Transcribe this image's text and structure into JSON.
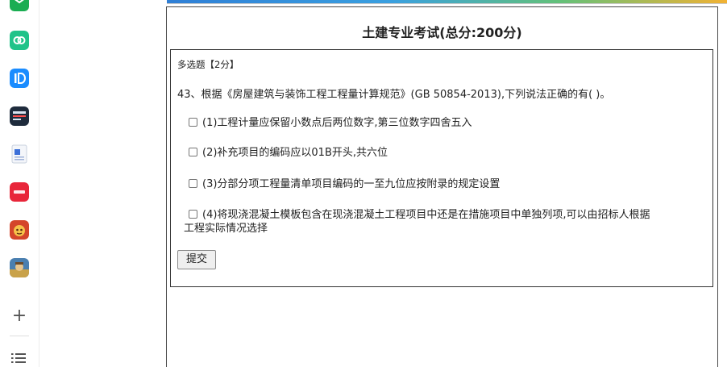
{
  "exam": {
    "title": "土建专业考试(总分:200分)"
  },
  "question": {
    "type_label": "多选题【2分】",
    "text": "43、根据《房屋建筑与装饰工程工程量计算规范》(GB 50854-2013),下列说法正确的有(    )。",
    "options": [
      {
        "label": "(1)工程计量应保留小数点后两位数字,第三位数字四舍五入"
      },
      {
        "label": "(2)补充项目的编码应以01B开头,共六位"
      },
      {
        "label": "(3)分部分项工程量清单项目编码的一至九位应按附录的规定设置"
      },
      {
        "label_line1": "(4)将现浇混凝土模板包含在现浇混凝土工程项目中还是在措施项目中单独列项,可以由招标人根据",
        "label_line2": "工程实际情况选择"
      }
    ],
    "submit_label": "提交"
  },
  "dock": {
    "add_symbol": "+",
    "apps": [
      {
        "icon": "mail-icon",
        "color": "#1aad52"
      },
      {
        "icon": "cloud-icon",
        "color": "#20c389"
      },
      {
        "icon": "id-icon",
        "color": "#1a8cff"
      },
      {
        "icon": "news-icon",
        "color": "#1e2b3c"
      },
      {
        "icon": "doc-icon",
        "color": "#3b6fd8"
      },
      {
        "icon": "shop-icon",
        "color": "#e8263a"
      },
      {
        "icon": "game-icon",
        "color": "#d4452b"
      },
      {
        "icon": "battle-icon",
        "color": "#4a7fb0"
      }
    ]
  }
}
